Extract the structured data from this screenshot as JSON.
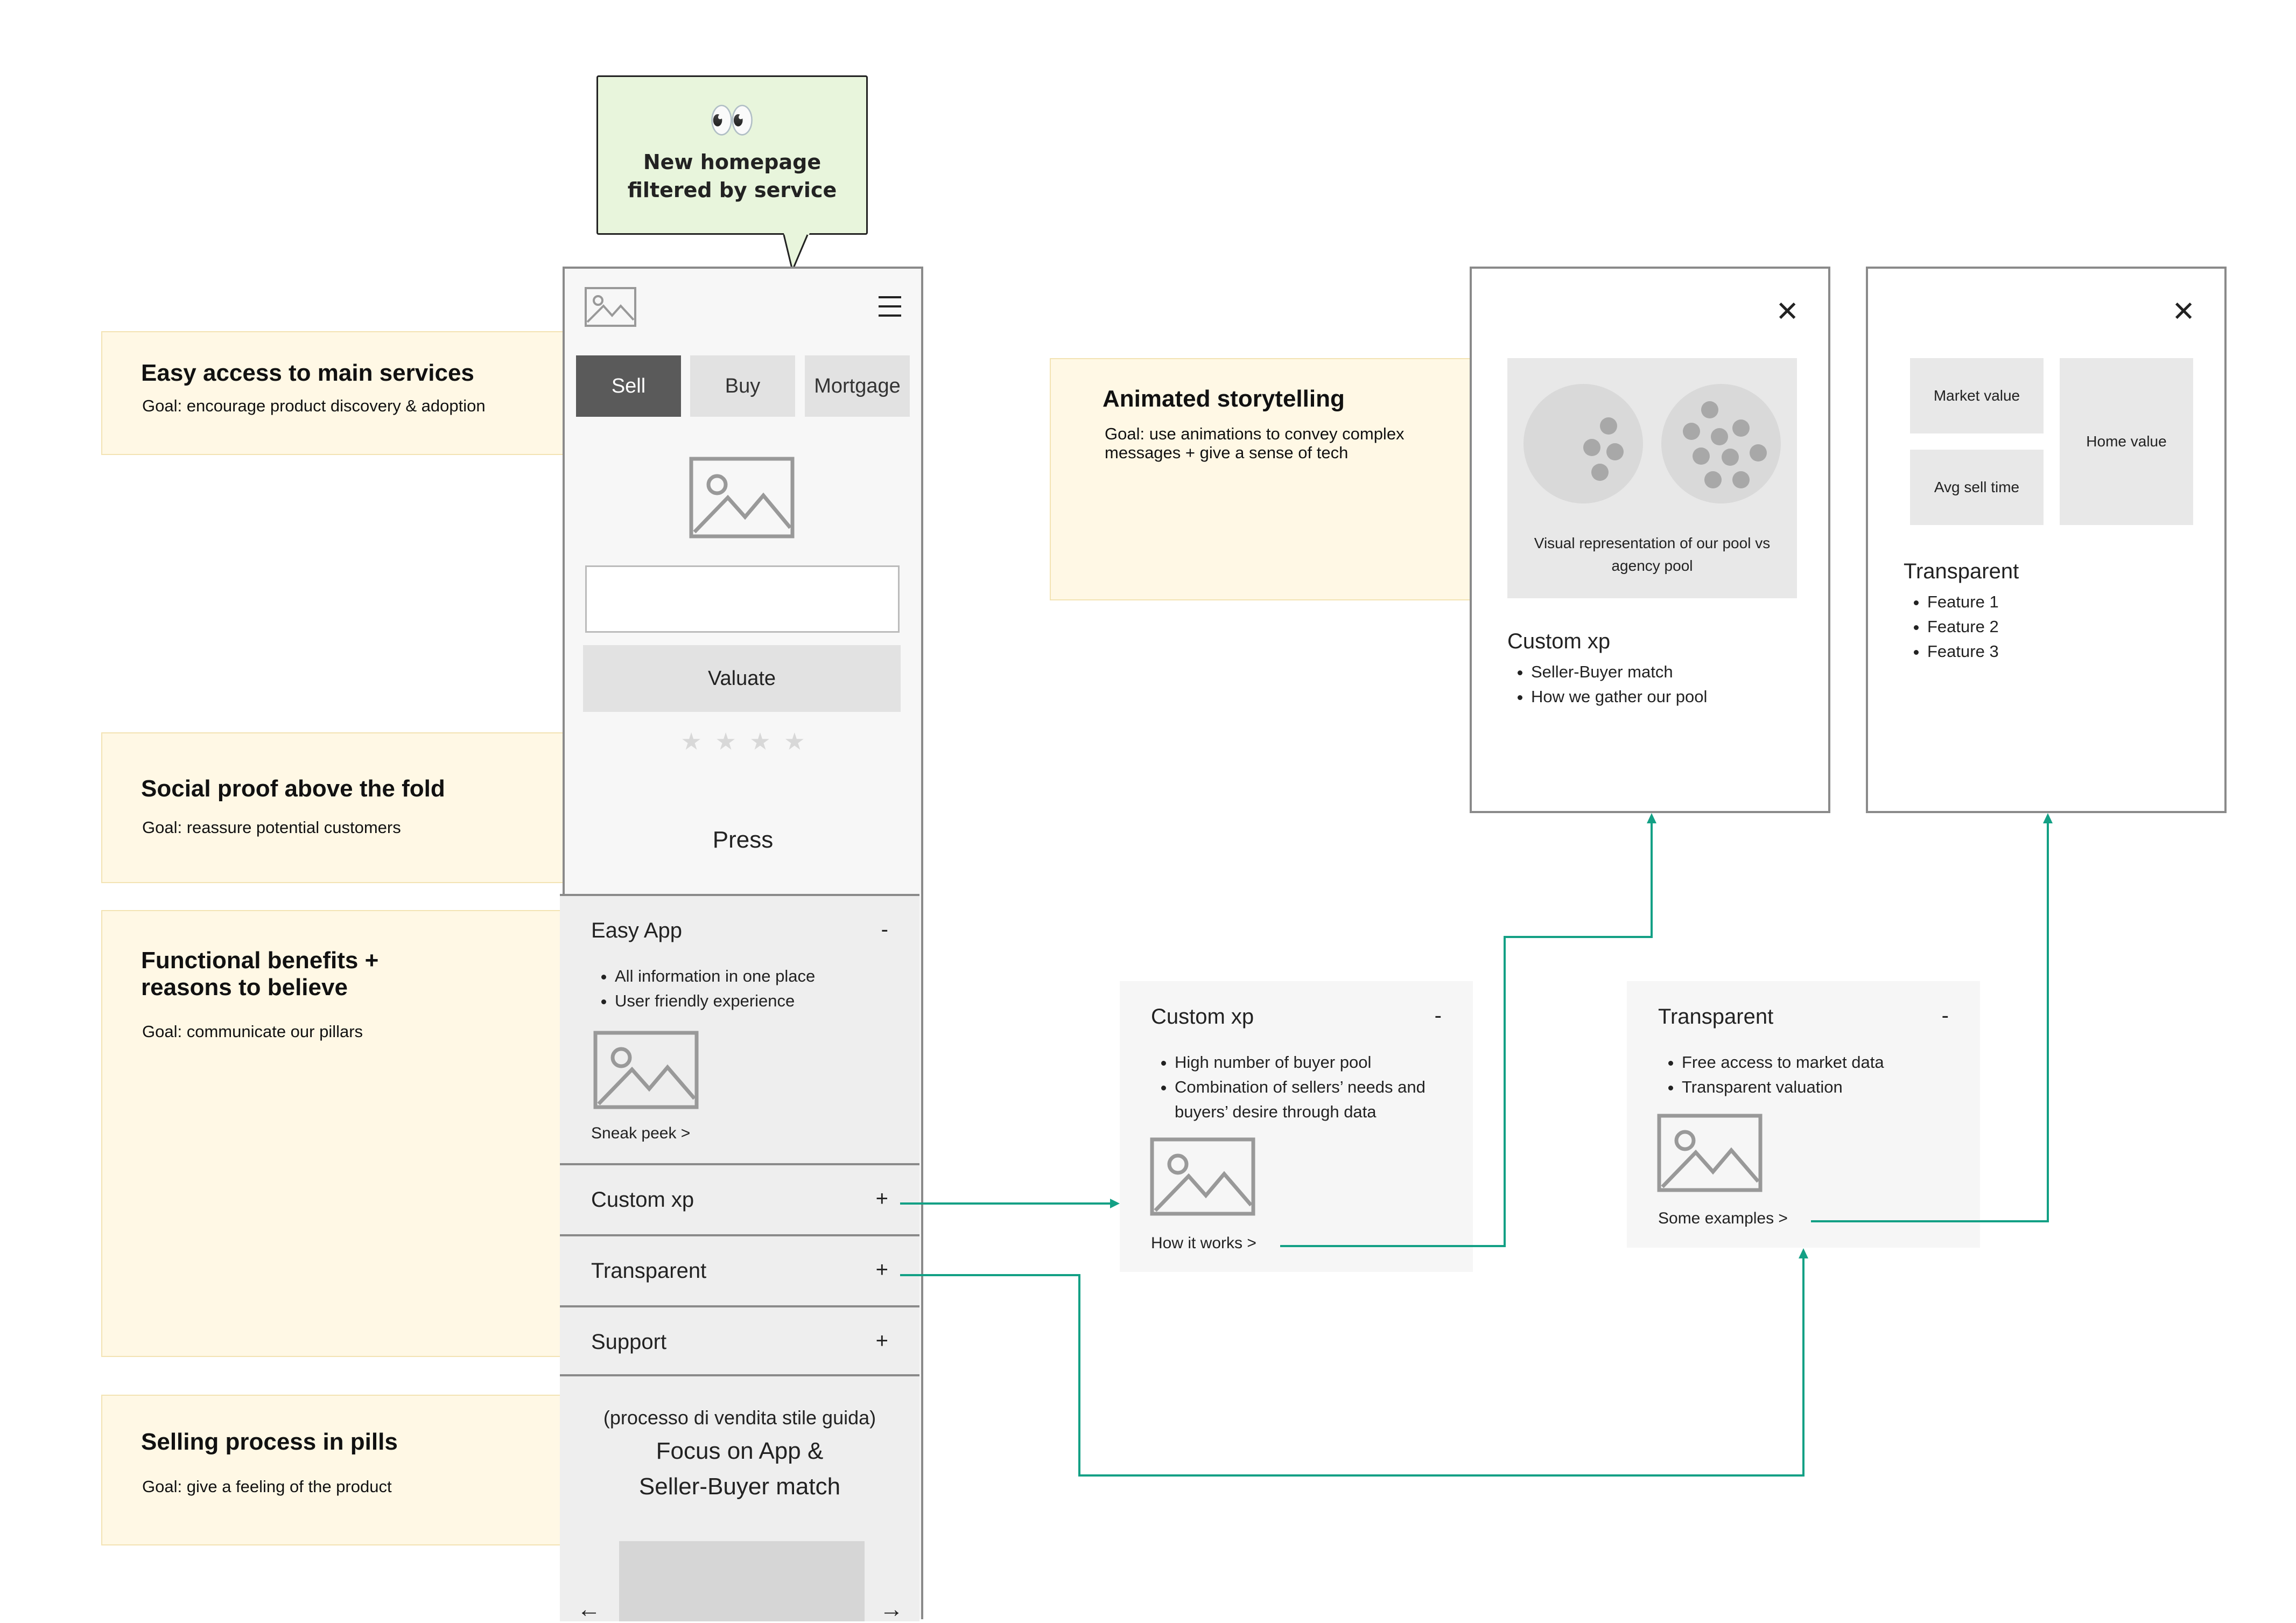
{
  "callout": {
    "icon": "👀",
    "line1": "New homepage",
    "line2": "filtered by service"
  },
  "notes": [
    {
      "title": "Easy access to main services",
      "goal": "Goal: encourage product discovery & adoption"
    },
    {
      "title": "Social proof above the fold",
      "goal": "Goal: reassure potential customers"
    },
    {
      "title_line1": "Functional benefits +",
      "title_line2": "reasons to believe",
      "goal": "Goal: communicate our pillars"
    },
    {
      "title": "Selling process in pills",
      "goal": "Goal: give a feeling of the product"
    },
    {
      "title": "Animated storytelling",
      "goal_line1": "Goal: use animations to convey complex",
      "goal_line2": "messages + give a sense of tech"
    }
  ],
  "phone": {
    "tabs": [
      "Sell",
      "Buy",
      "Mortgage"
    ],
    "valuate_label": "Valuate",
    "stars": "★  ★  ★  ★",
    "press": "Press",
    "easy_app": {
      "title": "Easy App",
      "toggle": "-",
      "bullets": [
        "All information in one place",
        "User friendly experience"
      ],
      "link": "Sneak peek >"
    },
    "custom_xp": {
      "title": "Custom xp",
      "toggle": "+"
    },
    "transparent": {
      "title": "Transparent",
      "toggle": "+"
    },
    "support": {
      "title": "Support",
      "toggle": "+"
    },
    "process": {
      "subtitle": "(processo di vendita stile guida)",
      "line1": "Focus on App &",
      "line2": "Seller-Buyer match"
    },
    "arrow_left": "←",
    "arrow_right": "→"
  },
  "panel_custom": {
    "title": "Custom xp",
    "toggle": "-",
    "bullets": [
      "High number of buyer pool",
      "Combination of sellers’ needs and",
      "buyers’ desire through data"
    ],
    "link": "How it works >"
  },
  "panel_transparent": {
    "title": "Transparent",
    "toggle": "-",
    "bullets": [
      "Free access to market data",
      "Transparent valuation"
    ],
    "link": "Some examples >"
  },
  "modal_custom": {
    "close": "✕",
    "caption_line1": "Visual representation of our pool vs",
    "caption_line2": "agency pool",
    "title": "Custom xp",
    "bullets": [
      "Seller-Buyer match",
      "How we gather our pool"
    ]
  },
  "modal_transparent": {
    "close": "✕",
    "market_value": "Market value",
    "home_value": "Home value",
    "avg_sell_time": "Avg sell time",
    "title": "Transparent",
    "bullets": [
      "Feature 1",
      "Feature 2",
      "Feature 3"
    ]
  },
  "colors": {
    "connector": "#13a085",
    "note_bg": "#fff8e5",
    "callout_bg": "#e8f5dc",
    "active_tab": "#5a5a5a"
  }
}
